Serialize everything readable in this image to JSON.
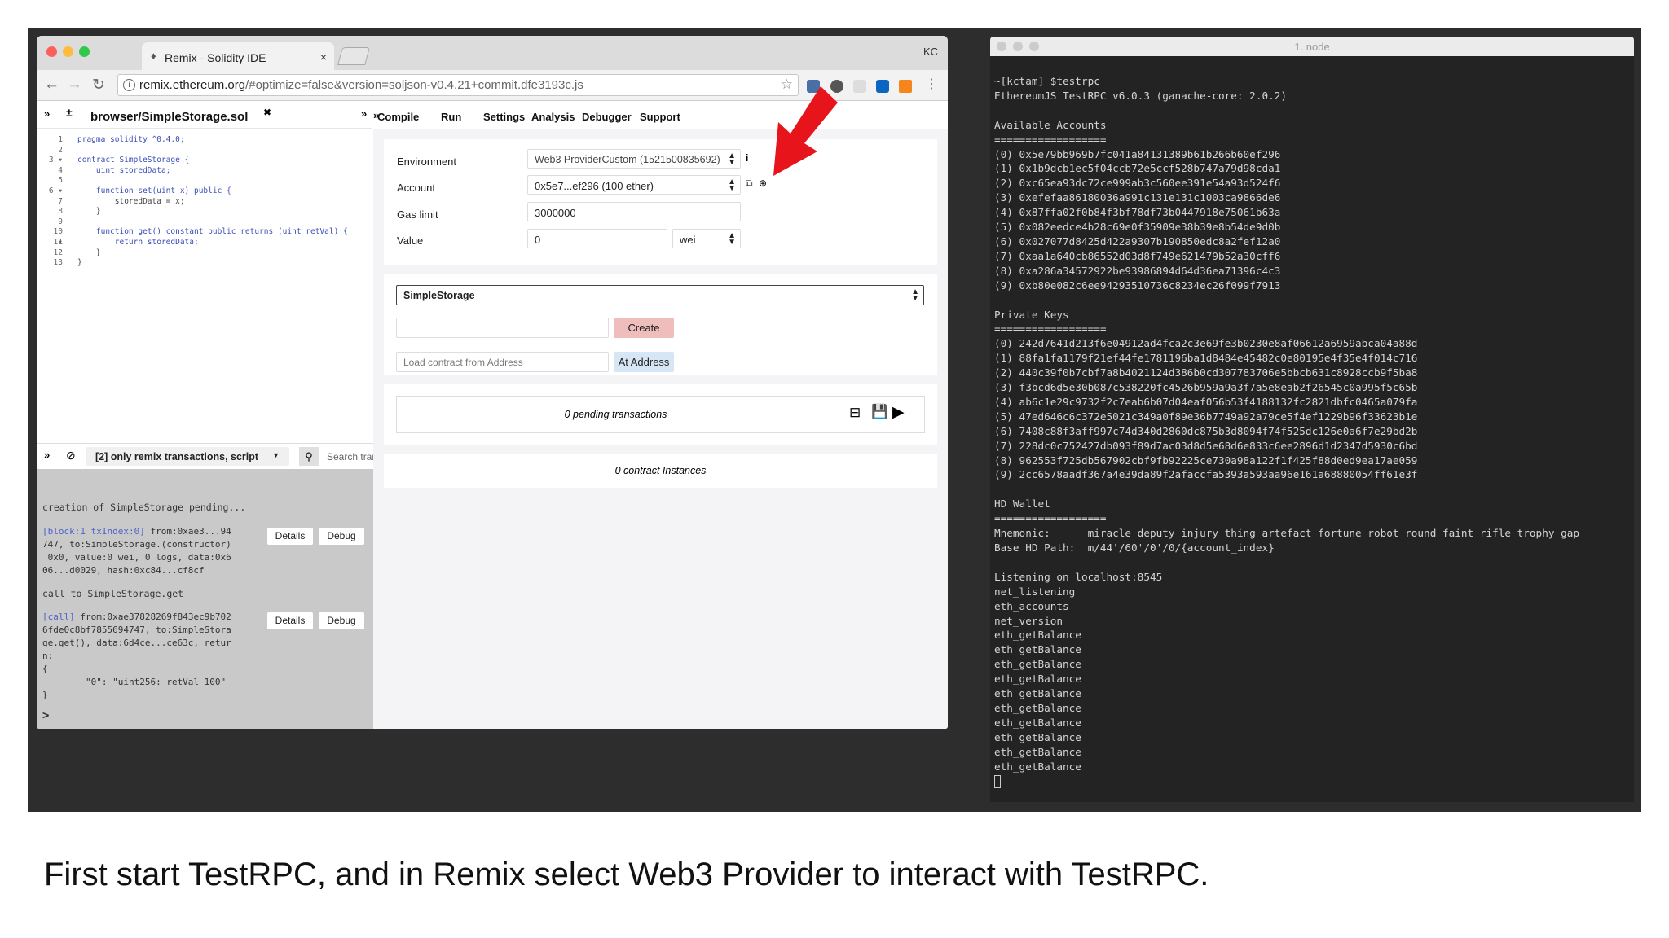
{
  "caption": "First start TestRPC, and in Remix select Web3 Provider to interact with TestRPC.",
  "browser": {
    "tab_title": "Remix - Solidity IDE",
    "tab_close": "×",
    "profile": "KC",
    "url_host": "remix.ethereum.org",
    "url_path": "/#optimize=false&version=soljson-v0.4.21+commit.dfe3193c.js"
  },
  "remix": {
    "file_tab": "browser/SimpleStorage.sol",
    "file_tab_close": "✖",
    "menu": [
      "Compile",
      "Run",
      "Settings",
      "Analysis",
      "Debugger",
      "Support"
    ],
    "code_lines": [
      {
        "n": "1",
        "t": "pragma solidity ^0.4.0;"
      },
      {
        "n": "2",
        "t": ""
      },
      {
        "n": "3 ▾",
        "t": "contract SimpleStorage {"
      },
      {
        "n": "4",
        "t": "    uint storedData;"
      },
      {
        "n": "5",
        "t": ""
      },
      {
        "n": "6 ▾",
        "t": "    function set(uint x) public {"
      },
      {
        "n": "7",
        "t": "        storedData = x;"
      },
      {
        "n": "8",
        "t": "    }"
      },
      {
        "n": "9",
        "t": ""
      },
      {
        "n": "10 ▾",
        "t": "    function get() constant public returns (uint retVal) {"
      },
      {
        "n": "11",
        "t": "        return storedData;"
      },
      {
        "n": "12",
        "t": "    }"
      },
      {
        "n": "13",
        "t": "}"
      }
    ],
    "run": {
      "environment_label": "Environment",
      "environment_value": "Web3 ProviderCustom (1521500835692)",
      "account_label": "Account",
      "account_value": "0x5e7...ef296 (100 ether)",
      "gas_label": "Gas limit",
      "gas_value": "3000000",
      "value_label": "Value",
      "value_value": "0",
      "value_unit": "wei",
      "contract_select": "SimpleStorage",
      "create_label": "Create",
      "load_placeholder": "Load contract from Address",
      "at_address_label": "At Address",
      "pending": "0 pending transactions",
      "instances": "0 contract Instances"
    },
    "terminal": {
      "filter": "[2] only remix transactions, script",
      "search_placeholder": "Search transactions",
      "line_pending": "creation of SimpleStorage pending...",
      "tx1_tag": "[block:1 txIndex:0]",
      "tx1_l1": " from:0xae3...94",
      "tx1_l2": "747, to:SimpleStorage.(constructor)",
      "tx1_l3": " 0x0, value:0 wei, 0 logs, data:0x6",
      "tx1_l4": "06...d0029, hash:0xc84...cf8cf",
      "line_call": "call to SimpleStorage.get",
      "tx2_tag": "[call]",
      "tx2_l1": " from:0xae37828269f843ec9b702",
      "tx2_l2": "6fde0c8bf7855694747, to:SimpleStora",
      "tx2_l3": "ge.get(), data:6d4ce...ce63c, retur",
      "tx2_l4": "n:",
      "tx2_l5": "{",
      "tx2_l6": "        \"0\": \"uint256: retVal 100\"",
      "tx2_l7": "}",
      "details_label": "Details",
      "debug_label": "Debug",
      "prompt": ">"
    }
  },
  "node_terminal": {
    "title": "1. node",
    "lines": [
      "~[kctam] $testrpc",
      "EthereumJS TestRPC v6.0.3 (ganache-core: 2.0.2)",
      "",
      "Available Accounts",
      "==================",
      "(0) 0x5e79bb969b7fc041a84131389b61b266b60ef296",
      "(1) 0x1b9dcb1ec5f04ccb72e5ccf528b747a79d98cda1",
      "(2) 0xc65ea93dc72ce999ab3c560ee391e54a93d524f6",
      "(3) 0xefefaa86180036a991c131e131c1003ca9866de6",
      "(4) 0x87ffa02f0b84f3bf78df73b0447918e75061b63a",
      "(5) 0x082eedce4b28c69e0f35909e38b39e8b54de9d0b",
      "(6) 0x027077d8425d422a9307b190850edc8a2fef12a0",
      "(7) 0xaa1a640cb86552d03d8f749e621479b52a30cff6",
      "(8) 0xa286a34572922be93986894d64d36ea71396c4c3",
      "(9) 0xb80e082c6ee94293510736c8234ec26f099f7913",
      "",
      "Private Keys",
      "==================",
      "(0) 242d7641d213f6e04912ad4fca2c3e69fe3b0230e8af06612a6959abca04a88d",
      "(1) 88fa1fa1179f21ef44fe178119 6ba1d8484e45482c0e80195e4f35e4f014c716",
      "(2) 440c39f0b7cbf7a8b4021124d386b0cd307783706e5bbcb631c8928ccb9f5ba8",
      "(3) f3bcd6d5e30b087c538220fc4526b959a9a3f7a5e8eab2f26545c0a995f5c65b",
      "(4) ab6c1e29c9732f2c7eab6b07d04eaf056b53f4188132fc2821dbfc0465a079fa",
      "(5) 47ed646c6c372e5021c349a0f89e36b7749a92a79ce5f4ef1229b96f33623b1e",
      "(6) 7408c88f3aff997c74d340d2860dc875b3d8094f74f525dc126e0a6f7e29bd2b",
      "(7) 228dc0c752427db093f89d7ac03d8d5e68d6e833c6ee2896d1d2347d5930c6bd",
      "(8) 962553f725db567902cbf9fb92225ce730a98a122f1f425f88d0ed9ea17ae059",
      "(9) 2cc6578aadf367a4e39da89f2afaccfa5393a593aa96e161a68880054ff61e3f",
      "",
      "HD Wallet",
      "==================",
      "Mnemonic:      miracle deputy injury thing artefact fortune robot round faint rifle trophy gap",
      "Base HD Path:  m/44'/60'/0'/0/{account_index}",
      "",
      "Listening on localhost:8545",
      "net_listening",
      "eth_accounts",
      "net_version",
      "eth_getBalance",
      "eth_getBalance",
      "eth_getBalance",
      "eth_getBalance",
      "eth_getBalance",
      "eth_getBalance",
      "eth_getBalance",
      "eth_getBalance",
      "eth_getBalance",
      "eth_getBalance"
    ]
  },
  "colors": {
    "create_button": "#f0bdbd",
    "at_address_button": "#d7e6f5",
    "arrow": "#e8141b"
  }
}
